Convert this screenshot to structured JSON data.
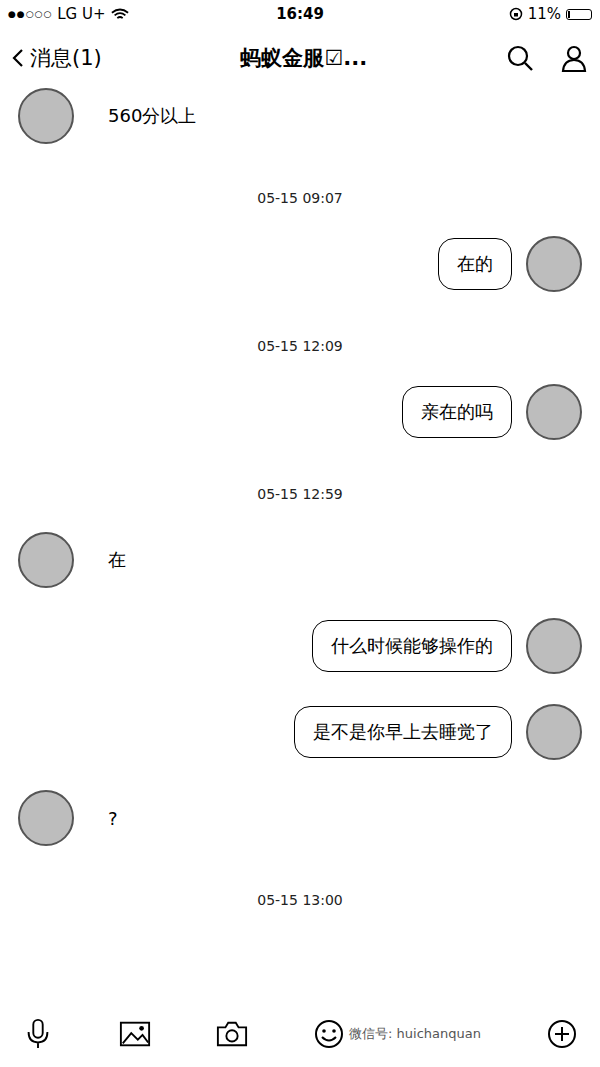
{
  "status_bar": {
    "signal": "●●○○○",
    "carrier": "LG U+",
    "time": "16:49",
    "battery": "11%",
    "battery_level": 0.11
  },
  "nav_bar": {
    "back": "消息(1)",
    "title": "蚂蚁金服☑..."
  },
  "messages": [
    {
      "kind": "message",
      "outgoing": false,
      "text": "560分以上"
    },
    {
      "kind": "time",
      "text": "05-15 09:07"
    },
    {
      "kind": "message",
      "outgoing": true,
      "text": "在的"
    },
    {
      "kind": "time",
      "text": "05-15 12:09"
    },
    {
      "kind": "message",
      "outgoing": true,
      "text": "亲在的吗"
    },
    {
      "kind": "time",
      "text": "05-15 12:59"
    },
    {
      "kind": "message",
      "outgoing": false,
      "text": "在"
    },
    {
      "kind": "message",
      "outgoing": true,
      "text": "什么时候能够操作的"
    },
    {
      "kind": "message",
      "outgoing": true,
      "text": "是不是你早上去睡觉了"
    },
    {
      "kind": "message",
      "outgoing": false,
      "text": "?"
    },
    {
      "kind": "time",
      "text": "05-15 13:00"
    }
  ],
  "watermark": "微信号: huichanquan"
}
